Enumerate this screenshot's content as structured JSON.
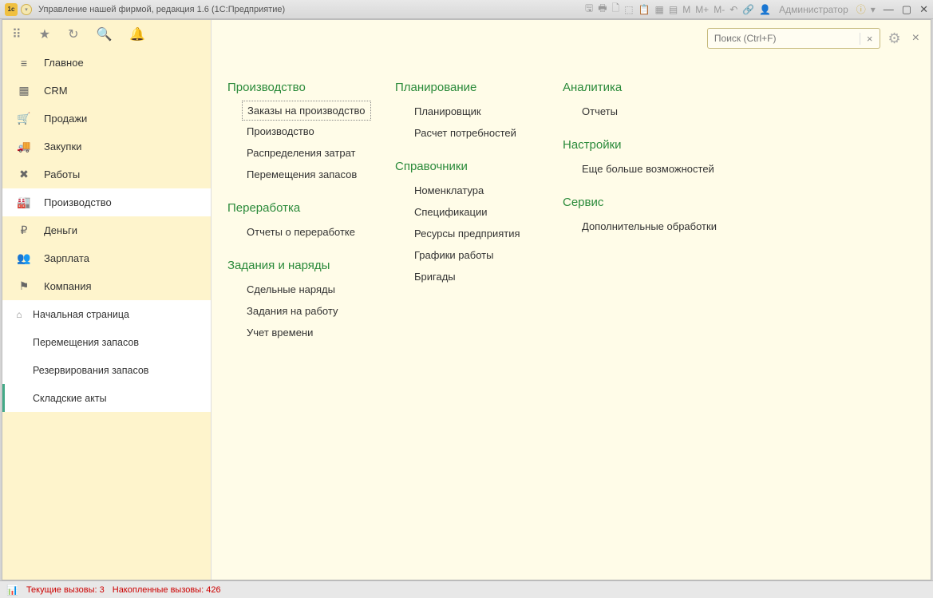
{
  "titlebar": {
    "app_title": "Управление нашей фирмой, редакция 1.6  (1С:Предприятие)",
    "admin_label": "Администратор",
    "m": "M",
    "m_plus": "M+",
    "m_minus": "M-"
  },
  "sidebar": {
    "items": [
      {
        "icon": "≡",
        "label": "Главное"
      },
      {
        "icon": "▦",
        "label": "CRM"
      },
      {
        "icon": "🛒",
        "label": "Продажи"
      },
      {
        "icon": "⛟",
        "label": "Закупки"
      },
      {
        "icon": "✖",
        "label": "Работы"
      },
      {
        "icon": "🏭",
        "label": "Производство"
      },
      {
        "icon": "₽",
        "label": "Деньги"
      },
      {
        "icon": "👥",
        "label": "Зарплата"
      },
      {
        "icon": "⚑",
        "label": "Компания"
      }
    ],
    "sub": [
      {
        "icon": "⌂",
        "label": "Начальная страница"
      },
      {
        "icon": "",
        "label": "Перемещения запасов"
      },
      {
        "icon": "",
        "label": "Резервирования запасов"
      },
      {
        "icon": "",
        "label": "Складские акты"
      }
    ]
  },
  "search": {
    "placeholder": "Поиск (Ctrl+F)"
  },
  "content": {
    "col1": {
      "h1": "Производство",
      "l1": [
        "Заказы на производство",
        "Производство",
        "Распределения затрат",
        "Перемещения запасов"
      ],
      "h2": "Переработка",
      "l2": [
        "Отчеты о переработке"
      ],
      "h3": "Задания и наряды",
      "l3": [
        "Сдельные наряды",
        "Задания на работу",
        "Учет времени"
      ]
    },
    "col2": {
      "h1": "Планирование",
      "l1": [
        "Планировщик",
        "Расчет потребностей"
      ],
      "h2": "Справочники",
      "l2": [
        "Номенклатура",
        "Спецификации",
        "Ресурсы предприятия",
        "Графики работы",
        "Бригады"
      ]
    },
    "col3": {
      "h1": "Аналитика",
      "l1": [
        "Отчеты"
      ],
      "h2": "Настройки",
      "l2": [
        "Еще больше возможностей"
      ],
      "h3": "Сервис",
      "l3": [
        "Дополнительные обработки"
      ]
    }
  },
  "statusbar": {
    "current": "Текущие вызовы:  3",
    "accumulated": "Накопленные вызовы:  426"
  }
}
